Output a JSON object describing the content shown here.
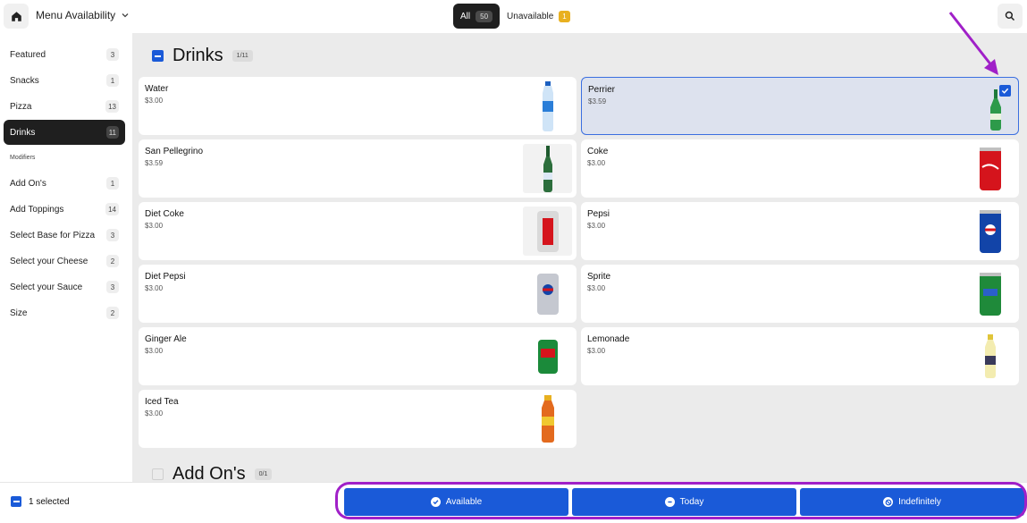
{
  "header": {
    "title": "Menu Availability",
    "filters": {
      "all_label": "All",
      "all_count": "50",
      "unavailable_label": "Unavailable",
      "unavailable_count": "1"
    }
  },
  "sidebar": {
    "items": [
      {
        "label": "Featured",
        "count": "3"
      },
      {
        "label": "Snacks",
        "count": "1"
      },
      {
        "label": "Pizza",
        "count": "13"
      },
      {
        "label": "Drinks",
        "count": "11"
      }
    ],
    "modifiers_heading": "Modifiers",
    "modifiers": [
      {
        "label": "Add On's",
        "count": "1"
      },
      {
        "label": "Add Toppings",
        "count": "14"
      },
      {
        "label": "Select Base for Pizza",
        "count": "3"
      },
      {
        "label": "Select your Cheese",
        "count": "2"
      },
      {
        "label": "Select your Sauce",
        "count": "3"
      },
      {
        "label": "Size",
        "count": "2"
      }
    ]
  },
  "main": {
    "drinks": {
      "title": "Drinks",
      "count": "1/11",
      "items": [
        {
          "name": "Water",
          "price": "$3.00"
        },
        {
          "name": "Perrier",
          "price": "$3.59"
        },
        {
          "name": "San Pellegrino",
          "price": "$3.59"
        },
        {
          "name": "Coke",
          "price": "$3.00"
        },
        {
          "name": "Diet Coke",
          "price": "$3.00"
        },
        {
          "name": "Pepsi",
          "price": "$3.00"
        },
        {
          "name": "Diet Pepsi",
          "price": "$3.00"
        },
        {
          "name": "Sprite",
          "price": "$3.00"
        },
        {
          "name": "Ginger Ale",
          "price": "$3.00"
        },
        {
          "name": "Lemonade",
          "price": "$3.00"
        },
        {
          "name": "Iced Tea",
          "price": "$3.00"
        }
      ]
    },
    "addons": {
      "title": "Add On's",
      "count": "0/1"
    }
  },
  "footer": {
    "selected_text": "1 selected",
    "actions": {
      "available": "Available",
      "today": "Today",
      "indefinitely": "Indefinitely"
    }
  },
  "colors": {
    "accent": "#1a5ad8",
    "annotation": "#a020c8",
    "badge_warning": "#e8b020"
  }
}
